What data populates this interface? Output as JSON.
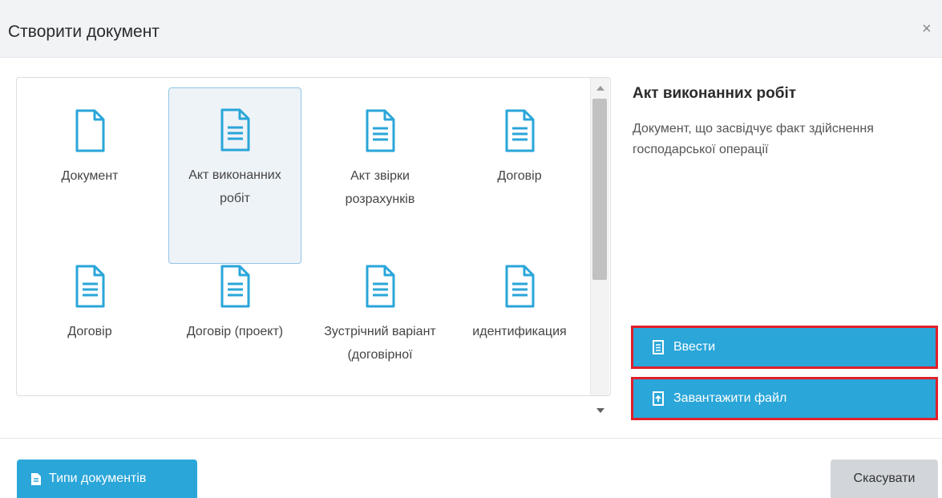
{
  "dialog": {
    "title": "Створити документ",
    "close_label": "×"
  },
  "document_types": [
    {
      "label": "Документ",
      "icon": "blank-document-icon",
      "selected": false
    },
    {
      "label": "Акт виконанних робіт",
      "icon": "document-icon",
      "selected": true
    },
    {
      "label": "Акт звірки розрахунків",
      "icon": "document-icon",
      "selected": false
    },
    {
      "label": "Договір",
      "icon": "document-icon",
      "selected": false
    },
    {
      "label": "Договір",
      "icon": "document-icon",
      "selected": false
    },
    {
      "label": "Договір (проект)",
      "icon": "document-icon",
      "selected": false
    },
    {
      "label": "Зустрічний варіант (договірної",
      "icon": "document-icon",
      "selected": false
    },
    {
      "label": "идентификация",
      "icon": "document-icon",
      "selected": false
    }
  ],
  "description": {
    "title": "Акт виконанних робіт",
    "text": "Документ, що засвідчує факт здійснення господарської операції"
  },
  "actions": {
    "enter_label": "Ввести",
    "upload_label": "Завантажити файл"
  },
  "footer": {
    "types_label": "Типи документів",
    "cancel_label": "Скасувати"
  },
  "colors": {
    "accent": "#2aa6d9",
    "icon": "#2aa6d9",
    "highlight_border": "#e0202a",
    "selected_bg": "#eef3f8"
  }
}
